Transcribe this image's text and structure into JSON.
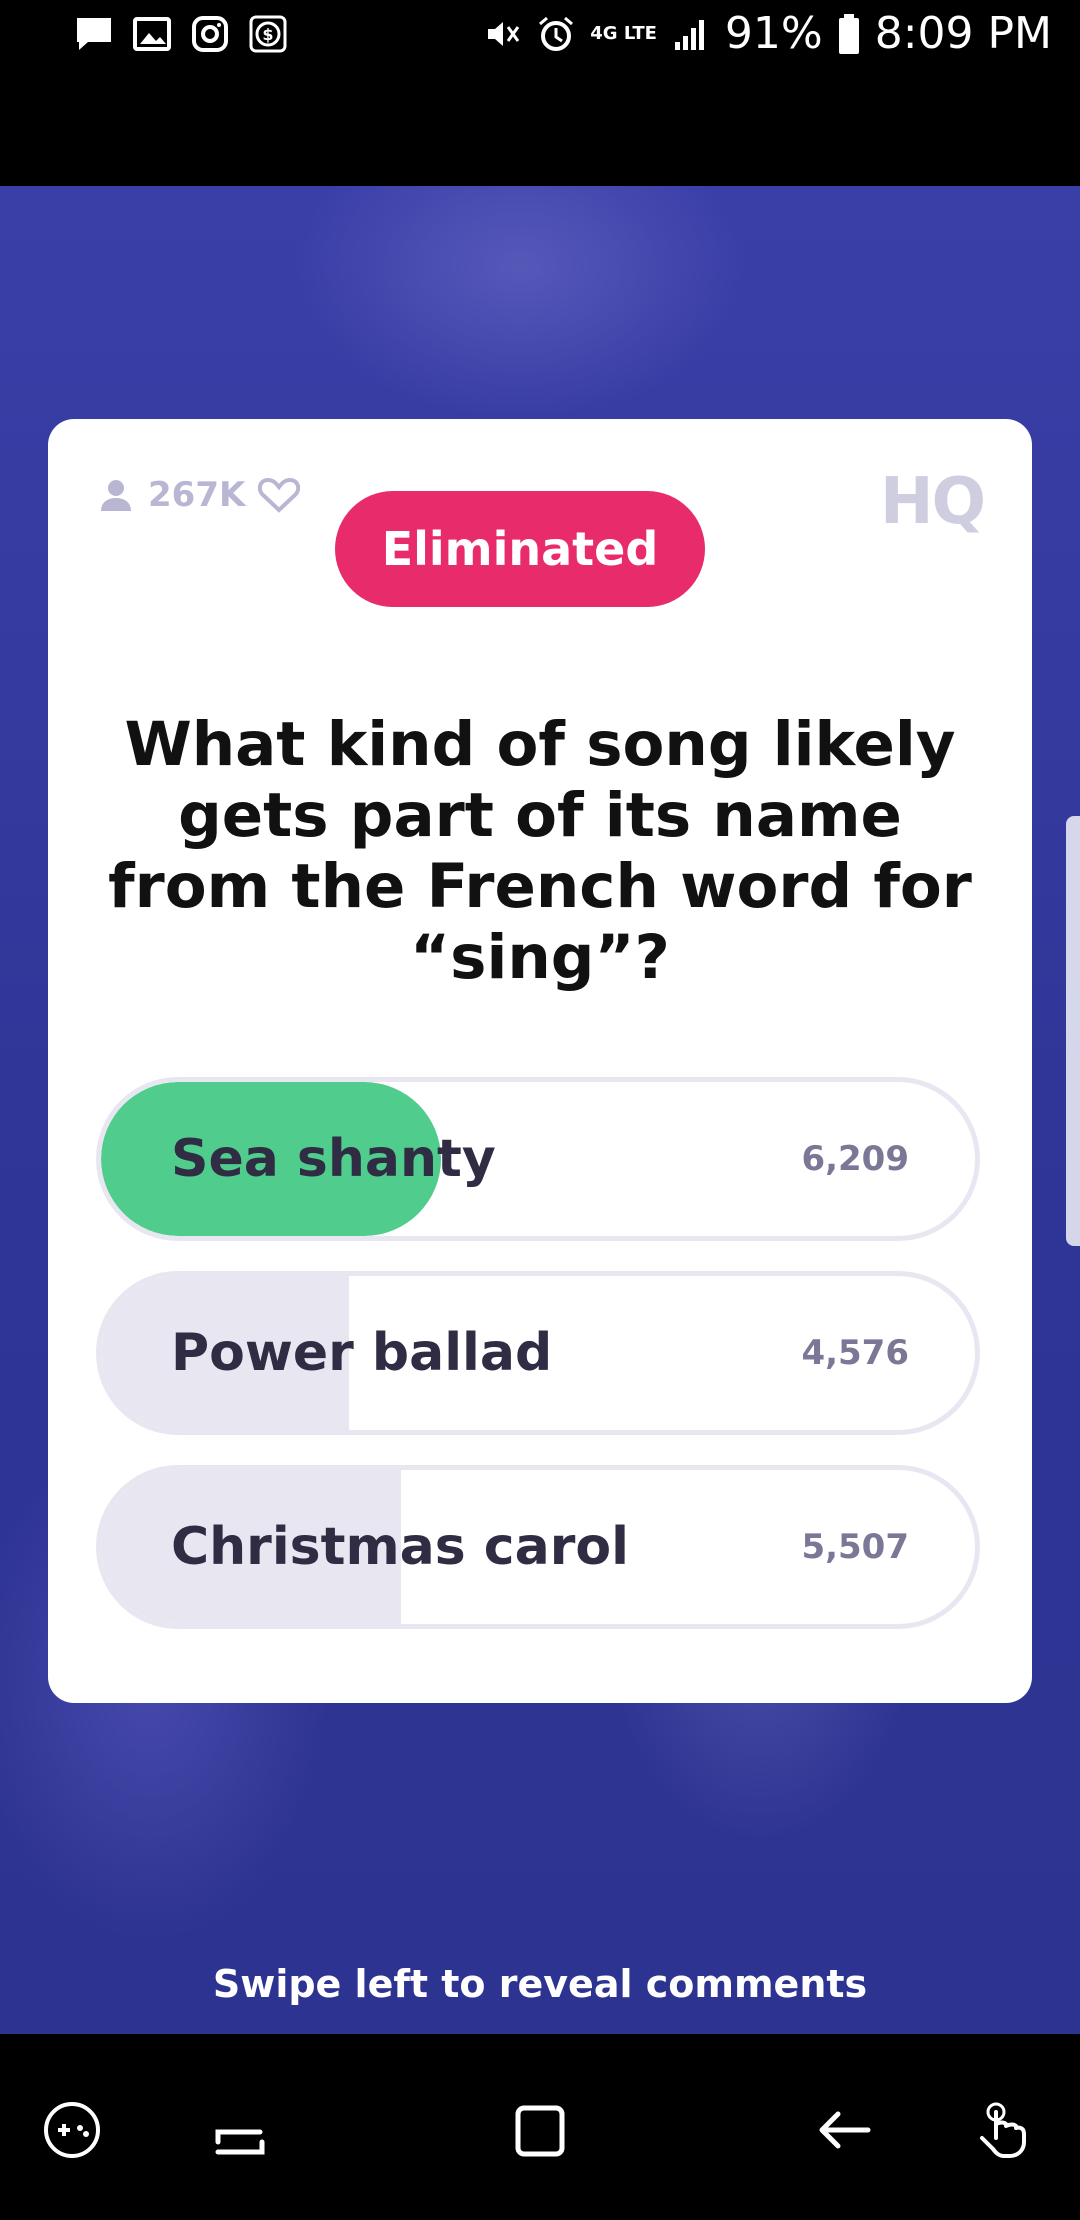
{
  "status_bar": {
    "battery": "91%",
    "time": "8:09 PM",
    "network": "4G LTE",
    "left_icons": [
      "message-icon",
      "gallery-icon",
      "instagram-icon",
      "dollar-icon"
    ],
    "right_icons": [
      "mute-icon",
      "alarm-icon",
      "network-icon",
      "signal-icon",
      "battery-icon"
    ]
  },
  "card": {
    "viewers": "267K",
    "logo": "HQ",
    "status_badge": "Eliminated",
    "status_color": "#e82c6b",
    "question": "What kind of song likely gets part of its name from the French word for “sing”?"
  },
  "answers": [
    {
      "label": "Sea shanty",
      "count": "6,209",
      "selected": true,
      "fill_fraction": 0.38,
      "fill_color": "#50cc8d"
    },
    {
      "label": "Power ballad",
      "count": "4,576",
      "selected": false,
      "fill_fraction": 0.28,
      "fill_color": "#e8e7f1"
    },
    {
      "label": "Christmas carol",
      "count": "5,507",
      "selected": false,
      "fill_fraction": 0.34,
      "fill_color": "#e8e7f1"
    }
  ],
  "swipe_hint": "Swipe left to reveal comments",
  "nav_bar": [
    "game-launcher-icon",
    "recent-apps-icon",
    "home-icon",
    "back-icon",
    "gesture-icon"
  ]
}
